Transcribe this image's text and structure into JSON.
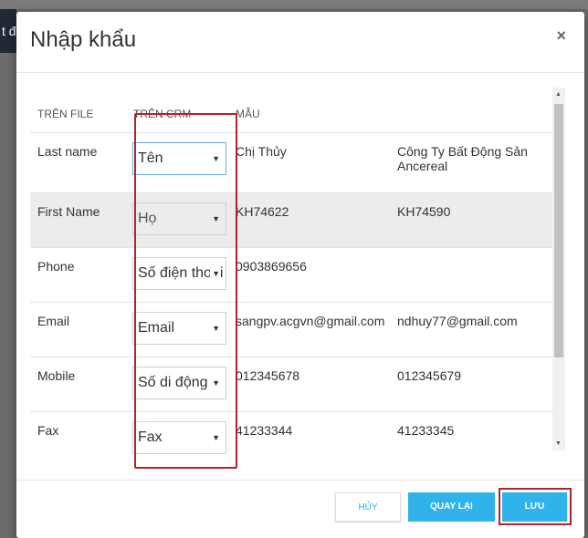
{
  "background": {
    "nav_fragment": "t đ"
  },
  "modal": {
    "title": "Nhập khẩu",
    "close_label": "×"
  },
  "table": {
    "headers": [
      "TRÊN FILE",
      "TRÊN CRM",
      "MẪU",
      ""
    ],
    "rows": [
      {
        "file": "Last name",
        "crm": "Tên",
        "sample1": "Chị Thủy",
        "sample2": "Công Ty Bất Động Sản Ancereal"
      },
      {
        "file": "First Name",
        "crm": "Họ",
        "sample1": "KH74622",
        "sample2": "KH74590"
      },
      {
        "file": "Phone",
        "crm": "Số điện thoại",
        "sample1": "0903869656",
        "sample2": ""
      },
      {
        "file": "Email",
        "crm": "Email",
        "sample1": "sangpv.acgvn@gmail.com",
        "sample2": "ndhuy77@gmail.com"
      },
      {
        "file": "Mobile",
        "crm": "Số di động",
        "sample1": "012345678",
        "sample2": "012345679"
      },
      {
        "file": "Fax",
        "crm": "Fax",
        "sample1": "41233344",
        "sample2": "41233345"
      }
    ]
  },
  "footer": {
    "cancel_label": "HỦY",
    "back_label": "QUAY LẠI",
    "save_label": "LƯU"
  },
  "colors": {
    "accent": "#30b3ea",
    "highlight": "#b0242b"
  }
}
